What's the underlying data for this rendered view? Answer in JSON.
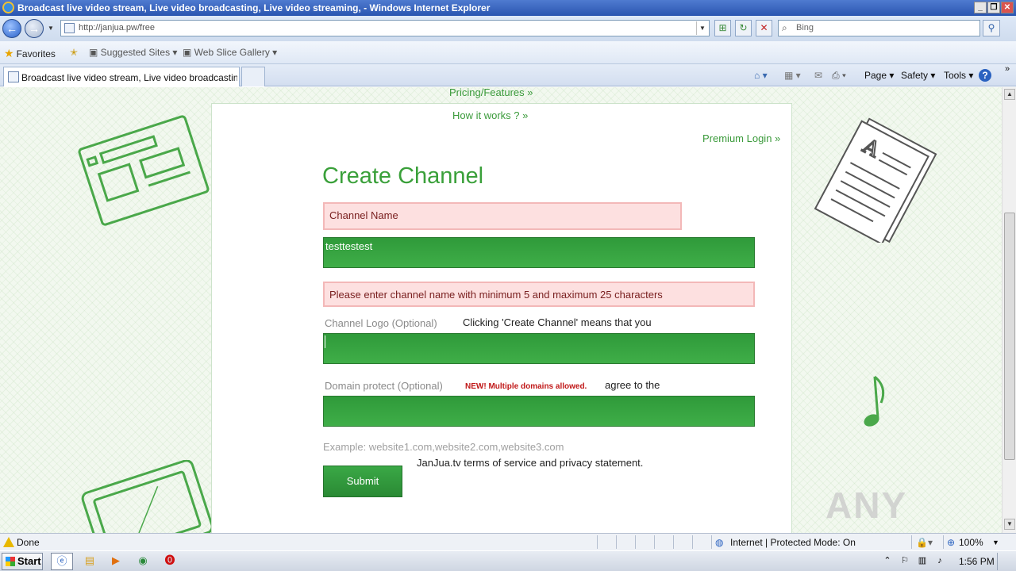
{
  "window": {
    "title": "Broadcast live video stream, Live video broadcasting, Live video streaming, - Windows Internet Explorer",
    "minimize": "_",
    "maximize": "❐",
    "close": "✕"
  },
  "address_bar": {
    "url": "http://janjua.pw/free",
    "search_placeholder": "Bing"
  },
  "favorites_bar": {
    "favorites_label": "Favorites",
    "suggested_sites": "Suggested Sites ▾",
    "web_slice_gallery": "Web Slice Gallery ▾"
  },
  "tabs": [
    {
      "label": "Broadcast live video stream, Live video broadcasting, ..."
    }
  ],
  "command_bar": {
    "page": "Page ▾",
    "safety": "Safety ▾",
    "tools": "Tools ▾",
    "help": "?"
  },
  "page": {
    "links": {
      "pricing": "Pricing/Features »",
      "how_it_works": "How it works ? »",
      "premium_login": "Premium Login »"
    },
    "heading": "Create Channel",
    "channel_name_label": "Channel Name",
    "channel_name_value": "testtestest",
    "channel_name_error": "Please enter channel name with minimum 5 and maximum 25 characters",
    "logo_label": "Channel Logo (Optional)",
    "terms_line1": "Clicking 'Create Channel' means that you",
    "domain_label": "Domain protect (Optional)",
    "domain_new_tag": "NEW! Multiple domains allowed.",
    "terms_line2": "agree to the",
    "domain_example": "Example: website1.com,website2.com,website3.com",
    "terms_line3": "JanJua.tv terms of service and privacy statement.",
    "submit_label": "Submit",
    "watermark": "ANY RUN"
  },
  "status_bar": {
    "status": "Done",
    "zone": "Internet | Protected Mode: On",
    "zoom": "100%"
  },
  "taskbar": {
    "start_label": "Start",
    "clock": "1:56 PM"
  },
  "colors": {
    "accent_green": "#3aa03a",
    "field_green": "#2f9a3a",
    "error_pink": "#fde0e0"
  }
}
